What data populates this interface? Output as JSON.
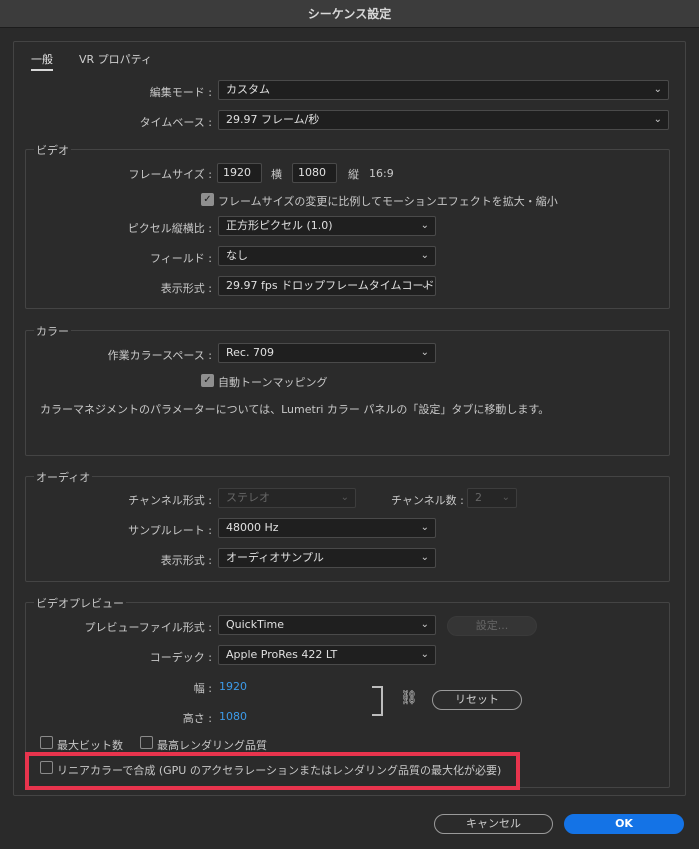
{
  "window": {
    "title": "シーケンス設定"
  },
  "tabs": [
    {
      "label": "一般",
      "active": true
    },
    {
      "label": "VR プロパティ",
      "active": false
    }
  ],
  "general": {
    "edit_mode_label": "編集モード :",
    "edit_mode_value": "カスタム",
    "timebase_label": "タイムベース :",
    "timebase_value": "29.97  フレーム/秒"
  },
  "video": {
    "title": "ビデオ",
    "frame_size_label": "フレームサイズ :",
    "width_value": "1920",
    "width_unit": "横",
    "height_value": "1080",
    "height_unit": "縦",
    "aspect": "16:9",
    "scale_motion_label": "フレームサイズの変更に比例してモーションエフェクトを拡大・縮小",
    "scale_motion_checked": true,
    "pixel_aspect_label": "ピクセル縦横比 :",
    "pixel_aspect_value": "正方形ピクセル (1.0)",
    "fields_label": "フィールド :",
    "fields_value": "なし",
    "display_format_label": "表示形式 :",
    "display_format_value": "29.97 fps ドロップフレームタイムコード"
  },
  "color": {
    "title": "カラー",
    "working_space_label": "作業カラースペース :",
    "working_space_value": "Rec. 709",
    "auto_tone_label": "自動トーンマッピング",
    "auto_tone_checked": true,
    "info_text": "カラーマネジメントのパラメーターについては、Lumetri カラー パネルの「設定」タブに移動します。"
  },
  "audio": {
    "title": "オーディオ",
    "channel_format_label": "チャンネル形式 :",
    "channel_format_value": "ステレオ",
    "channel_count_label": "チャンネル数 :",
    "channel_count_value": "2",
    "sample_rate_label": "サンプルレート :",
    "sample_rate_value": "48000 Hz",
    "display_format_label": "表示形式 :",
    "display_format_value": "オーディオサンプル"
  },
  "preview": {
    "title": "ビデオプレビュー",
    "file_format_label": "プレビューファイル形式 :",
    "file_format_value": "QuickTime",
    "settings_button": "設定...",
    "codec_label": "コーデック :",
    "codec_value": "Apple ProRes 422 LT",
    "width_label": "幅 :",
    "width_value": "1920",
    "height_label": "高さ :",
    "height_value": "1080",
    "reset_button": "リセット"
  },
  "options": {
    "max_bit_depth": "最大ビット数",
    "max_render_quality": "最高レンダリング品質",
    "linear_color": "リニアカラーで合成 (GPU のアクセラレーションまたはレンダリング品質の最大化が必要)"
  },
  "footer": {
    "cancel": "キャンセル",
    "ok": "OK"
  },
  "colors": {
    "accent": "#1473e6",
    "highlight": "#e8344d",
    "link": "#3d9be9"
  }
}
